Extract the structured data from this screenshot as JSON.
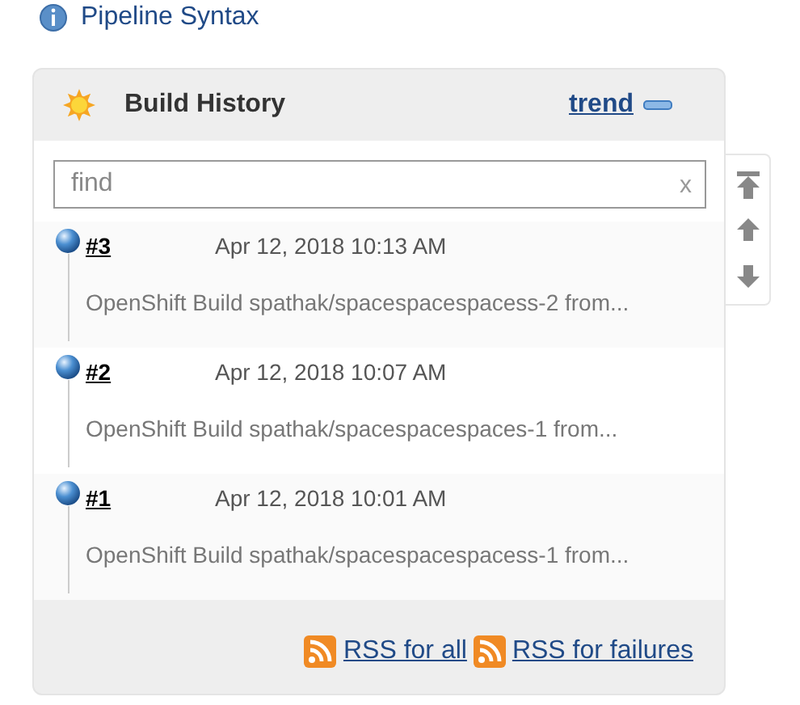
{
  "top_link": {
    "label": "Pipeline Syntax"
  },
  "panel": {
    "title": "Build History",
    "trend_link": "trend"
  },
  "search": {
    "placeholder": "find",
    "clear": "x"
  },
  "builds": [
    {
      "number": "#3",
      "date": "Apr 12, 2018 10:13 AM",
      "description": "OpenShift Build spathak/spacespacespacess-2 from..."
    },
    {
      "number": "#2",
      "date": "Apr 12, 2018 10:07 AM",
      "description": "OpenShift Build spathak/spacespacespaces-1 from..."
    },
    {
      "number": "#1",
      "date": "Apr 12, 2018 10:01 AM",
      "description": "OpenShift Build spathak/spacespacespacess-1 from..."
    }
  ],
  "footer_links": [
    "RSS for all",
    "RSS for failures"
  ]
}
